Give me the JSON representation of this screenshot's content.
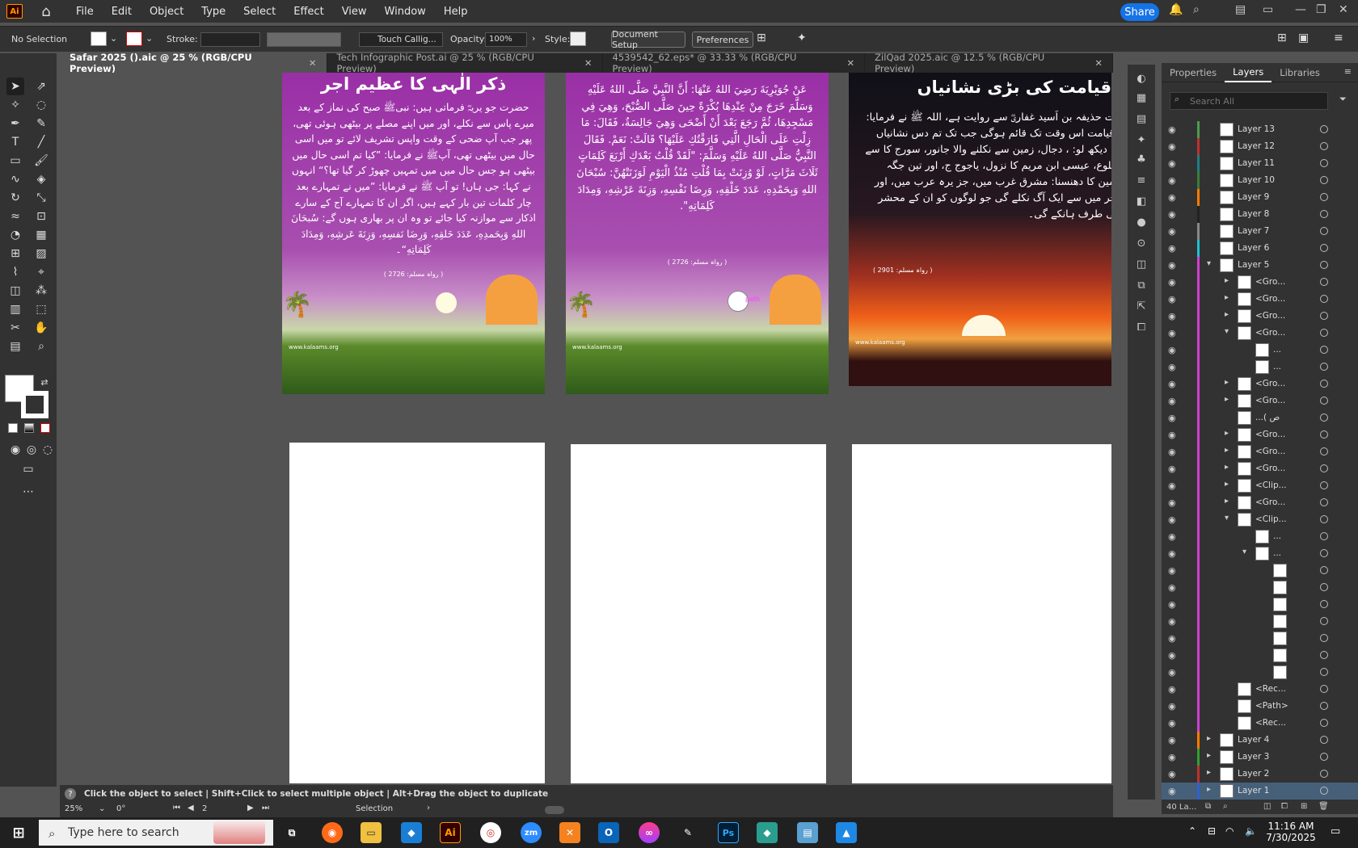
{
  "app": {
    "logo": "Ai",
    "menu": [
      "File",
      "Edit",
      "Object",
      "Type",
      "Select",
      "Effect",
      "View",
      "Window",
      "Help"
    ],
    "share_label": "Share"
  },
  "control_bar": {
    "selection": "No Selection",
    "stroke_label": "Stroke:",
    "brush": "Touch Callig...",
    "opacity_label": "Opacity:",
    "opacity_value": "100%",
    "style_label": "Style:",
    "document_setup": "Document Setup",
    "preferences": "Preferences"
  },
  "tabs": [
    {
      "label": "Safar 2025 ().aic @ 25 % (RGB/CPU Preview)",
      "active": true
    },
    {
      "label": "Tech Infographic Post.ai @ 25 % (RGB/CPU Preview)",
      "active": false
    },
    {
      "label": "4539542_62.eps* @ 33.33 % (RGB/CPU Preview)",
      "active": false
    },
    {
      "label": "ZilQad 2025.aic @ 12.5 % (RGB/CPU Preview)",
      "active": false
    }
  ],
  "artboards": {
    "a1": {
      "title": "ذکر الٰہی کا عظیم اجر",
      "body": "حضرت جو یریہؓ فرماتی ہیں: نبیﷺ صبح کی نماز کے بعد میرے پاس سے نکلے، اور میں اپنے مصلے پر بیٹھی ہوئی تھی، پھر جب آپ ضحی کے وقت واپس تشریف لائے تو میں اسی حال میں بیٹھی تھی، آپﷺ نے فرمایا: ”کیا تم اسی حال میں بیٹھی ہو جس حال میں میں تمہیں چھوڑ کر گیا تھا؟“ انہوں نے کہا: جی ہاں! تو آپ ﷺ نے فرمایا: ”میں نے تمہارے بعد چار کلمات تین بار کہے ہیں، اگر ان کا تمہارے آج کے سارے اذکار سے موازنہ کیا جائے تو وہ ان پر بھاری ہوں گے: سُبحَانَ اللهِ وَبِحَمدِهِ، عَدَدَ خَلقِهِ، وَرِضَا نَفسِهِ، وَزِنَةَ عَرشِهِ، وَمِدَادَ كَلِمَاتِهِ“۔",
      "ref": "( رواہ مسلم: 2726 )",
      "site": "www.kalaams.org"
    },
    "a2": {
      "body": "عَنْ جُوَيْرِيَةَ رَضِيَ اللهُ عَنْهَا: أَنَّ النَّبِيَّ صَلَّى اللهُ عَلَيْهِ وَسَلَّمَ خَرَجَ مِنْ عِنْدِهَا بُكْرَةً حِينَ صَلَّى الصُّبْحَ، وَهِيَ فِي مَسْجِدِهَا، ثُمَّ رَجَعَ بَعْدَ أَنْ أَضْحَى وَهِيَ جَالِسَةٌ، فَقَالَ: مَا زِلْتِ عَلَى الْحَالِ الَّتِي فَارَقْتُكِ عَلَيْهَا؟ قَالَتْ: نَعَمْ. فَقَالَ النَّبِيُّ صَلَّى اللهُ عَلَيْهِ وَسَلَّمَ: \"لَقَدْ قُلْتُ بَعْدَكِ أَرْبَعَ كَلِمَاتٍ ثَلَاثَ مَرَّاتٍ، لَوْ وُزِنَتْ بِمَا قُلْتِ مُنْذُ الْيَوْمِ لَوَزَنَتْهُنَّ: سُبْحَانَ اللهِ وَبِحَمْدِهِ، عَدَدَ خَلْقِهِ، وَرِضَا نَفْسِهِ، وَزِنَةَ عَرْشِهِ، وَمِدَادَ كَلِمَاتِهِ\".",
      "ref": "( رواہ مسلم: 2726 )",
      "site": "www.kalaams.org",
      "path_label": "path"
    },
    "a3": {
      "title": "قیامت کی بڑی نشانیاں",
      "body": "رت حذیفہ بن اَسید غفاریؓ سے روایت ہے، اللہ ﷺ نے فرمایا: ”قیامت اس وقت تک قائم ہوگی جب تک تم دس نشانیاں نہ دیکھ لو: ، دجال، زمین سے نکلنے والا جانور، سورج کا سے طلوع، عیسی ابن مریم کا نزول، یاجوج ج، اور تین جگہ زمین کا دھنسنا: مشرق غرب میں، جز یرہ عرب میں، اور آخر میں سے ایک آگ نکلے گی جو لوگوں کو ان کے محشر کی طرف ہانکے گی۔",
      "ref": "( رواہ مسلم: 2901 )",
      "site": "www.kalaams.org"
    }
  },
  "status": {
    "hint": "Click the object to select  |  Shift+Click to select multiple object  |  Alt+Drag the object to duplicate",
    "zoom": "25%",
    "rotation": "0°",
    "artboard_num": "2",
    "mode": "Selection"
  },
  "layers_panel": {
    "tabs": [
      "Properties",
      "Layers",
      "Libraries"
    ],
    "active_tab": "Layers",
    "search_placeholder": "Search All",
    "count": "40 La...",
    "rows": [
      {
        "name": "Layer 13",
        "color": "#4f9a4f",
        "indent": 0,
        "arrow": ""
      },
      {
        "name": "Layer 12",
        "color": "#c03030",
        "indent": 0,
        "arrow": ""
      },
      {
        "name": "Layer 11",
        "color": "#1d8080",
        "indent": 0,
        "arrow": ""
      },
      {
        "name": "Layer 10",
        "color": "#3a7d3a",
        "indent": 0,
        "arrow": ""
      },
      {
        "name": "Layer 9",
        "color": "#ff7a00",
        "indent": 0,
        "arrow": ""
      },
      {
        "name": "Layer 8",
        "color": "#222222",
        "indent": 0,
        "arrow": ""
      },
      {
        "name": "Layer 7",
        "color": "#888888",
        "indent": 0,
        "arrow": ""
      },
      {
        "name": "Layer 6",
        "color": "#20c0d0",
        "indent": 0,
        "arrow": ""
      },
      {
        "name": "Layer 5",
        "color": "#d040d0",
        "indent": 0,
        "arrow": "v"
      },
      {
        "name": "<Gro...",
        "color": "#d040d0",
        "indent": 1,
        "arrow": ">"
      },
      {
        "name": "<Gro...",
        "color": "#d040d0",
        "indent": 1,
        "arrow": ">"
      },
      {
        "name": "<Gro...",
        "color": "#d040d0",
        "indent": 1,
        "arrow": ">"
      },
      {
        "name": "<Gro...",
        "color": "#d040d0",
        "indent": 1,
        "arrow": "v"
      },
      {
        "name": "...",
        "color": "#d040d0",
        "indent": 2,
        "arrow": ""
      },
      {
        "name": "...",
        "color": "#d040d0",
        "indent": 2,
        "arrow": ""
      },
      {
        "name": "<Gro...",
        "color": "#d040d0",
        "indent": 1,
        "arrow": ">"
      },
      {
        "name": "<Gro...",
        "color": "#d040d0",
        "indent": 1,
        "arrow": ">"
      },
      {
        "name": "...( ص",
        "color": "#d040d0",
        "indent": 1,
        "arrow": ""
      },
      {
        "name": "<Gro...",
        "color": "#d040d0",
        "indent": 1,
        "arrow": ">"
      },
      {
        "name": "<Gro...",
        "color": "#d040d0",
        "indent": 1,
        "arrow": ">"
      },
      {
        "name": "<Gro...",
        "color": "#d040d0",
        "indent": 1,
        "arrow": ">"
      },
      {
        "name": "<Clip...",
        "color": "#d040d0",
        "indent": 1,
        "arrow": ">"
      },
      {
        "name": "<Gro...",
        "color": "#d040d0",
        "indent": 1,
        "arrow": ">"
      },
      {
        "name": "<Clip...",
        "color": "#d040d0",
        "indent": 1,
        "arrow": "v"
      },
      {
        "name": "...",
        "color": "#d040d0",
        "indent": 2,
        "arrow": ""
      },
      {
        "name": "...",
        "color": "#d040d0",
        "indent": 2,
        "arrow": "v"
      },
      {
        "name": "",
        "color": "#d040d0",
        "indent": 3,
        "arrow": ""
      },
      {
        "name": "",
        "color": "#d040d0",
        "indent": 3,
        "arrow": ""
      },
      {
        "name": "",
        "color": "#d040d0",
        "indent": 3,
        "arrow": ""
      },
      {
        "name": "",
        "color": "#d040d0",
        "indent": 3,
        "arrow": ""
      },
      {
        "name": "",
        "color": "#d040d0",
        "indent": 3,
        "arrow": ""
      },
      {
        "name": "",
        "color": "#d040d0",
        "indent": 3,
        "arrow": ""
      },
      {
        "name": "",
        "color": "#d040d0",
        "indent": 3,
        "arrow": ""
      },
      {
        "name": "<Rec...",
        "color": "#d040d0",
        "indent": 1,
        "arrow": ""
      },
      {
        "name": "<Path>",
        "color": "#d040d0",
        "indent": 1,
        "arrow": ""
      },
      {
        "name": "<Rec...",
        "color": "#d040d0",
        "indent": 1,
        "arrow": ""
      },
      {
        "name": "Layer 4",
        "color": "#ff7a00",
        "indent": 0,
        "arrow": ">"
      },
      {
        "name": "Layer 3",
        "color": "#30a030",
        "indent": 0,
        "arrow": ">"
      },
      {
        "name": "Layer 2",
        "color": "#c03030",
        "indent": 0,
        "arrow": ">"
      },
      {
        "name": "Layer 1",
        "color": "#3060d0",
        "indent": 0,
        "arrow": ">",
        "selected": true
      }
    ]
  },
  "taskbar": {
    "search_placeholder": "Type here to search",
    "time": "11:16 AM",
    "date": "7/30/2025"
  }
}
